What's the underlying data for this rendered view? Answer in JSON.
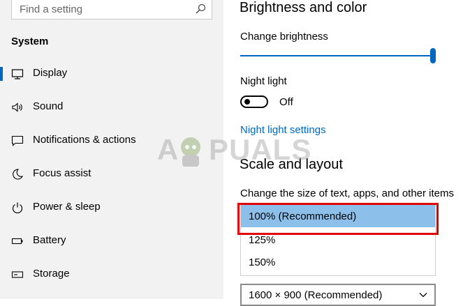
{
  "search": {
    "placeholder": "Find a setting",
    "icon": "search-icon"
  },
  "sidebar": {
    "section_title": "System",
    "items": [
      {
        "label": "Display",
        "icon": "display-icon",
        "selected": true
      },
      {
        "label": "Sound",
        "icon": "speaker-icon"
      },
      {
        "label": "Notifications & actions",
        "icon": "notification-icon"
      },
      {
        "label": "Focus assist",
        "icon": "moon-icon"
      },
      {
        "label": "Power & sleep",
        "icon": "power-icon"
      },
      {
        "label": "Battery",
        "icon": "battery-icon"
      },
      {
        "label": "Storage",
        "icon": "storage-icon"
      }
    ]
  },
  "main": {
    "brightness_heading": "Brightness and color",
    "change_brightness_label": "Change brightness",
    "brightness_level": 1.0,
    "night_light_label": "Night light",
    "night_light_state": "Off",
    "night_light_settings_link": "Night light settings",
    "scale_heading": "Scale and layout",
    "scale_label": "Change the size of text, apps, and other items",
    "scale_options": [
      "100% (Recommended)",
      "125%",
      "150%"
    ],
    "scale_selected": "100% (Recommended)",
    "resolution_value": "1600 × 900 (Recommended)"
  },
  "watermark": {
    "text": "A PUALS"
  },
  "colors": {
    "accent": "#0067c0",
    "highlight": "#8cc0ea",
    "annotation_red": "#e00000"
  }
}
